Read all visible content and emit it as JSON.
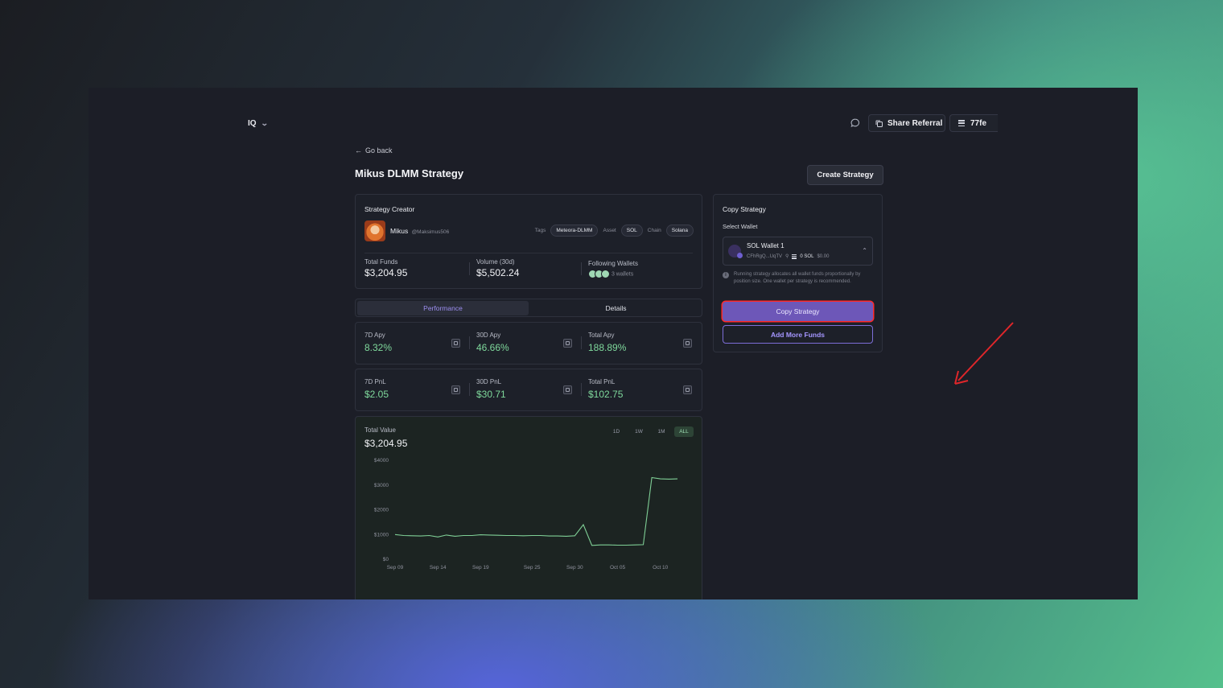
{
  "topbar": {
    "brand": "IQ",
    "share_referral": "Share Referral",
    "wallet_short": "77fe"
  },
  "nav": {
    "go_back": "Go back"
  },
  "page": {
    "title": "Mikus DLMM Strategy",
    "create_button": "Create Strategy"
  },
  "creator": {
    "heading": "Strategy Creator",
    "name": "Mikus",
    "handle": "@Maksimus506",
    "tags_label": "Tags",
    "tag": "Meteora-DLMM",
    "asset_label": "Asset",
    "asset": "SOL",
    "chain_label": "Chain",
    "chain": "Solana",
    "total_funds_label": "Total Funds",
    "total_funds": "$3,204.95",
    "volume_label": "Volume (30d)",
    "volume": "$5,502.24",
    "following_label": "Following Wallets",
    "following_count": "3 wallets"
  },
  "tabs": [
    {
      "label": "Performance",
      "active": true
    },
    {
      "label": "Details",
      "active": false
    }
  ],
  "apy": [
    {
      "label": "7D Apy",
      "value": "8.32%"
    },
    {
      "label": "30D Apy",
      "value": "46.66%"
    },
    {
      "label": "Total Apy",
      "value": "188.89%"
    }
  ],
  "pnl": [
    {
      "label": "7D PnL",
      "value": "$2.05"
    },
    {
      "label": "30D PnL",
      "value": "$30.71"
    },
    {
      "label": "Total PnL",
      "value": "$102.75"
    }
  ],
  "chart_panel": {
    "label": "Total Value",
    "value": "$3,204.95",
    "timeframes": [
      "1D",
      "1W",
      "1M",
      "ALL"
    ],
    "selected_timeframe": "ALL"
  },
  "chart_data": {
    "type": "line",
    "title": "Total Value",
    "ylim": [
      0,
      4000
    ],
    "ytick_labels": [
      "$4000",
      "$3000",
      "$2000",
      "$1000",
      "$0"
    ],
    "ytick_values": [
      4000,
      3000,
      2000,
      1000,
      0
    ],
    "xtick_labels": [
      "Sep 09",
      "Sep 14",
      "Sep 19",
      "Sep 25",
      "Sep 30",
      "Oct 05",
      "Oct 10"
    ],
    "xlim": [
      "2024-09-09",
      "2024-10-12"
    ],
    "xtick_dates": [
      "2024-09-09",
      "2024-09-14",
      "2024-09-19",
      "2024-09-25",
      "2024-09-30",
      "2024-10-05",
      "2024-10-10"
    ],
    "color": "#7fcf96",
    "series": [
      {
        "x": [
          "2024-09-09",
          "2024-09-10",
          "2024-09-11",
          "2024-09-12",
          "2024-09-13",
          "2024-09-14",
          "2024-09-15",
          "2024-09-16",
          "2024-09-17",
          "2024-09-18",
          "2024-09-19",
          "2024-09-20",
          "2024-09-21",
          "2024-09-22",
          "2024-09-23",
          "2024-09-24",
          "2024-09-25",
          "2024-09-26",
          "2024-09-27",
          "2024-09-28",
          "2024-09-29",
          "2024-09-30",
          "2024-10-01",
          "2024-10-02",
          "2024-10-03",
          "2024-10-04",
          "2024-10-05",
          "2024-10-06",
          "2024-10-07",
          "2024-10-08",
          "2024-10-09",
          "2024-10-10",
          "2024-10-11",
          "2024-10-12"
        ],
        "y": [
          1000,
          960,
          950,
          940,
          960,
          900,
          980,
          930,
          960,
          960,
          990,
          980,
          970,
          960,
          960,
          950,
          960,
          960,
          940,
          940,
          930,
          950,
          1400,
          560,
          580,
          580,
          570,
          570,
          580,
          590,
          3300,
          3250,
          3240,
          3250
        ]
      }
    ],
    "grid": false
  },
  "copy": {
    "heading": "Copy Strategy",
    "select_wallet_label": "Select Wallet",
    "wallet_name": "SOL Wallet 1",
    "wallet_address": "CFhRgQ...UqTV",
    "wallet_balance": "0 SOL",
    "wallet_usd": "$0.00",
    "info_text": "Running strategy allocates all wallet funds proportionally by position size. One wallet per strategy is recommended.",
    "copy_button": "Copy Strategy",
    "add_funds_button": "Add More Funds"
  },
  "colors": {
    "accent": "#6d57b8",
    "positive": "#7fd99c",
    "highlight": "#ff2a2a"
  }
}
